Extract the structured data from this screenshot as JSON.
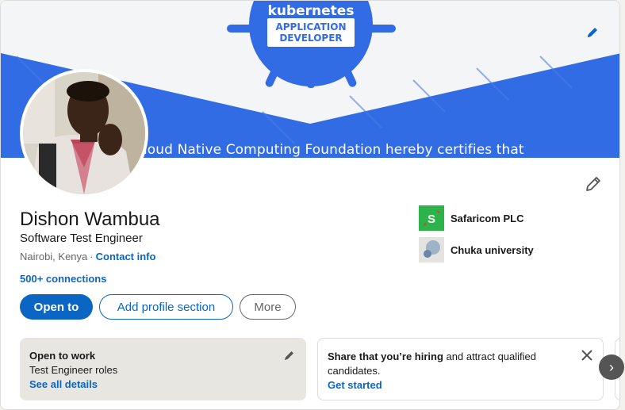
{
  "banner": {
    "badge_line1": "kubernetes",
    "badge_line2": "APPLICATION",
    "badge_line3": "DEVELOPER",
    "certificate_text": "Cloud Native Computing Foundation hereby certifies that",
    "edit_icon": "pencil-icon"
  },
  "profile": {
    "name": "Dishon Wambua",
    "headline": "Software Test Engineer",
    "location": "Nairobi, Kenya",
    "separator": "·",
    "contact_info_label": "Contact info",
    "connections": "500+ connections",
    "edit_icon": "pencil-icon"
  },
  "actions": {
    "open_to": "Open to",
    "add_section": "Add profile section",
    "more": "More"
  },
  "organizations": [
    {
      "name": "Safaricom PLC",
      "logo_letter": "S",
      "logo_color": "#2db34a",
      "accent": "#e53935"
    },
    {
      "name": "Chuka university",
      "logo_color": "#e5e3df",
      "circle_a": "#9fb3c8",
      "circle_b": "#6b86a8"
    }
  ],
  "open_to_work": {
    "title": "Open to work",
    "roles": "Test Engineer roles",
    "details_link": "See all details"
  },
  "hiring": {
    "bold_text": "Share that you’re hiring",
    "rest_text": " and attract qualified candidates.",
    "link": "Get started"
  },
  "carousel": {
    "next_icon": "›"
  },
  "colors": {
    "brand_blue": "#0a66c2",
    "banner_blue": "#326ce5",
    "panel_gray": "#e8e6e1"
  }
}
